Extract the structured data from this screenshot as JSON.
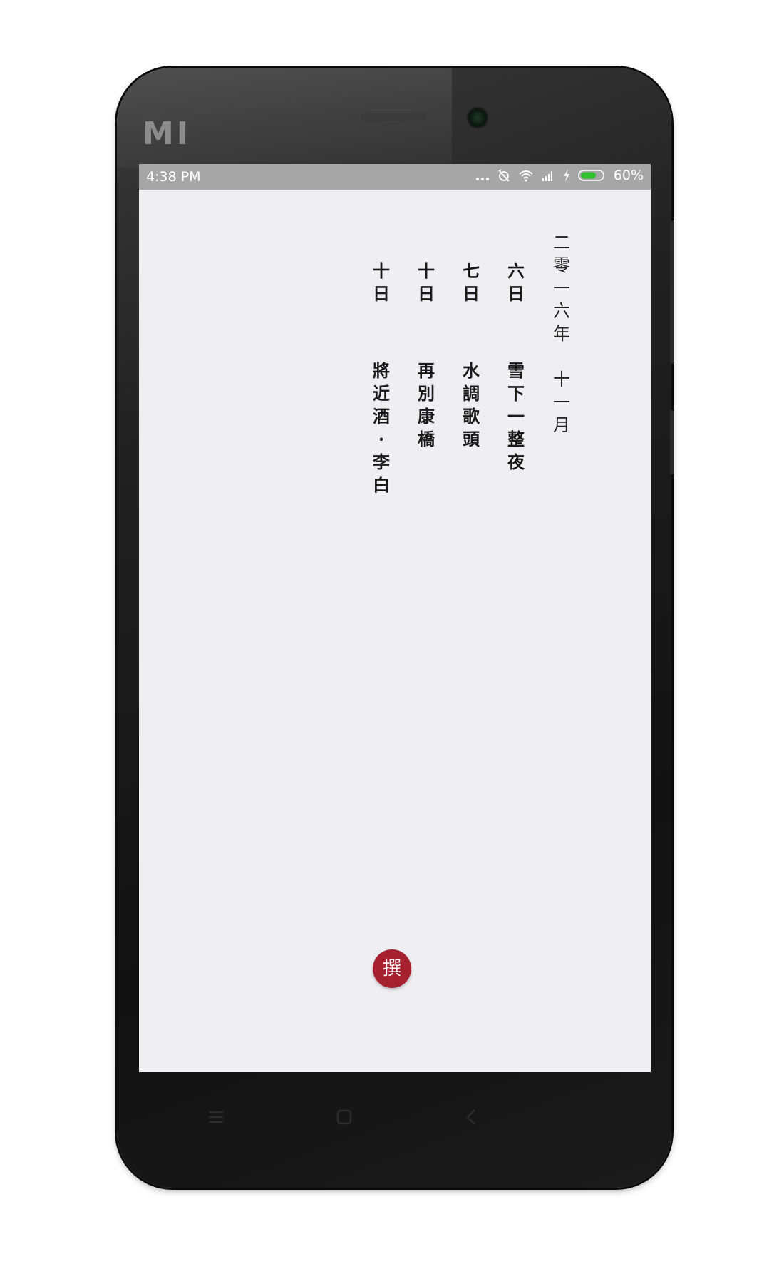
{
  "device": {
    "brand_logo": "MI"
  },
  "status_bar": {
    "time": "4:38 PM",
    "battery_percent": "60%",
    "icons": [
      "more-dots-icon",
      "alarm-off-icon",
      "wifi-icon",
      "signal-icon",
      "charging-icon",
      "battery-icon"
    ]
  },
  "journal": {
    "year": [
      "二",
      "零",
      "一",
      "六",
      "年"
    ],
    "month": [
      "十",
      "一",
      "月"
    ],
    "entries": [
      {
        "day": [
          "六",
          "日"
        ],
        "title": [
          "雪",
          "下",
          "一",
          "整",
          "夜"
        ]
      },
      {
        "day": [
          "七",
          "日"
        ],
        "title": [
          "水",
          "調",
          "歌",
          "頭"
        ]
      },
      {
        "day": [
          "十",
          "日"
        ],
        "title": [
          "再",
          "別",
          "康",
          "橋"
        ]
      },
      {
        "day": [
          "十",
          "日"
        ],
        "title": [
          "將",
          "近",
          "酒",
          "·",
          "李",
          "白"
        ]
      }
    ]
  },
  "fab": {
    "label": "撰",
    "color": "#a5212f"
  },
  "nav_bar": {
    "icons": [
      "menu-icon",
      "home-icon",
      "back-icon"
    ]
  }
}
